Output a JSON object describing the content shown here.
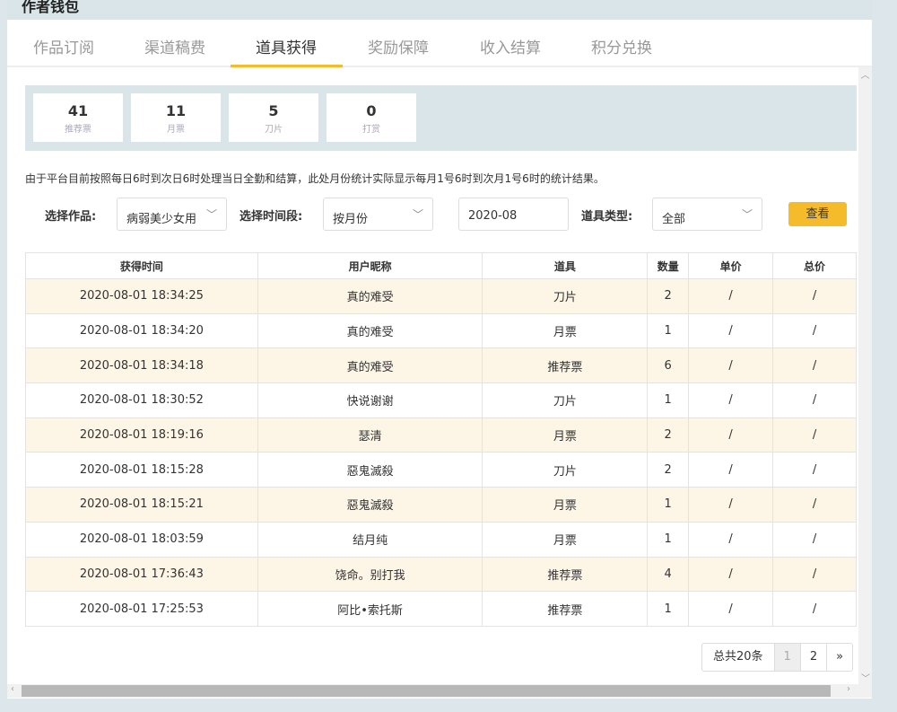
{
  "header": {
    "title": "作者钱包"
  },
  "tabs": [
    {
      "label": "作品订阅"
    },
    {
      "label": "渠道稿费"
    },
    {
      "label": "道具获得",
      "active": true
    },
    {
      "label": "奖励保障"
    },
    {
      "label": "收入结算"
    },
    {
      "label": "积分兑换"
    }
  ],
  "stats": [
    {
      "value": "41",
      "label": "推荐票"
    },
    {
      "value": "11",
      "label": "月票"
    },
    {
      "value": "5",
      "label": "刀片"
    },
    {
      "value": "0",
      "label": "打赏"
    }
  ],
  "note": "由于平台目前按照每日6时到次日6时处理当日全勤和结算，此处月份统计实际显示每月1号6时到次月1号6时的统计结果。",
  "filters": {
    "work_label": "选择作品:",
    "work_value": "病弱美少女用",
    "period_label": "选择时间段:",
    "period_value": "按月份",
    "month_value": "2020-08",
    "type_label": "道具类型:",
    "type_value": "全部",
    "submit": "查看"
  },
  "table": {
    "headers": [
      "获得时间",
      "用户昵称",
      "道具",
      "数量",
      "单价",
      "总价"
    ],
    "rows": [
      [
        "2020-08-01 18:34:25",
        "真的难受",
        "刀片",
        "2",
        "/",
        "/"
      ],
      [
        "2020-08-01 18:34:20",
        "真的难受",
        "月票",
        "1",
        "/",
        "/"
      ],
      [
        "2020-08-01 18:34:18",
        "真的难受",
        "推荐票",
        "6",
        "/",
        "/"
      ],
      [
        "2020-08-01 18:30:52",
        "快说谢谢",
        "刀片",
        "1",
        "/",
        "/"
      ],
      [
        "2020-08-01 18:19:16",
        "瑟清",
        "月票",
        "2",
        "/",
        "/"
      ],
      [
        "2020-08-01 18:15:28",
        "惡鬼滅殺",
        "刀片",
        "2",
        "/",
        "/"
      ],
      [
        "2020-08-01 18:15:21",
        "惡鬼滅殺",
        "月票",
        "1",
        "/",
        "/"
      ],
      [
        "2020-08-01 18:03:59",
        "结月纯",
        "月票",
        "1",
        "/",
        "/"
      ],
      [
        "2020-08-01 17:36:43",
        "饶命。别打我",
        "推荐票",
        "4",
        "/",
        "/"
      ],
      [
        "2020-08-01 17:25:53",
        "阿比•索托斯",
        "推荐票",
        "1",
        "/",
        "/"
      ]
    ]
  },
  "pager": {
    "total": "总共20条",
    "pages": [
      "1",
      "2"
    ],
    "current": "1",
    "next": "»"
  },
  "colors": {
    "accent": "#f6bb2a",
    "row_alt": "#fdf5e6",
    "panel": "#dae5e9"
  }
}
